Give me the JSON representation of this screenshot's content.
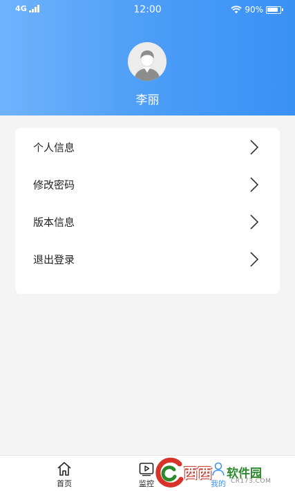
{
  "status_bar": {
    "network": "4G",
    "time": "12:00",
    "battery_pct": "90%",
    "battery_level": 0.9
  },
  "profile": {
    "name": "李丽"
  },
  "menu": {
    "items": [
      {
        "label": "个人信息"
      },
      {
        "label": "修改密码"
      },
      {
        "label": "版本信息"
      },
      {
        "label": "退出登录"
      }
    ]
  },
  "tabbar": {
    "tabs": [
      {
        "label": "首页",
        "icon": "home-icon"
      },
      {
        "label": "监控",
        "icon": "play-icon"
      },
      {
        "label": "我的",
        "icon": "user-icon",
        "active": true
      }
    ]
  },
  "watermark": {
    "brand": "西西",
    "subtitle": "软件园",
    "url": "CR173.COM"
  },
  "colors": {
    "accent": "#3a91f5",
    "header_gradient_start": "#6fb3fc",
    "header_gradient_end": "#3a91f5",
    "background": "#f4f4f5"
  }
}
